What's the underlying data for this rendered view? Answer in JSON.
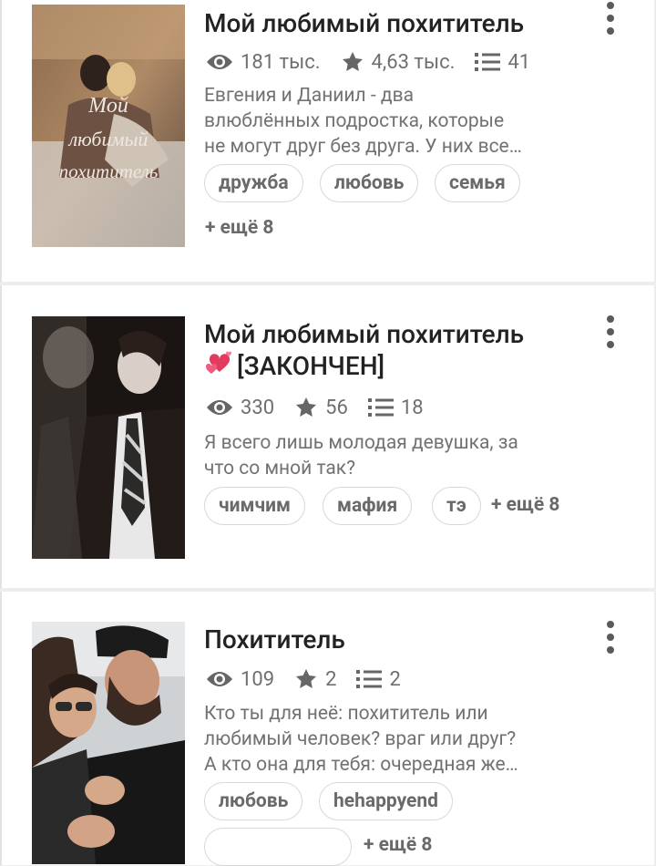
{
  "stories": [
    {
      "title": "Мой любимый похититель",
      "views": "181 тыс.",
      "votes": "4,63 тыс.",
      "parts": "41",
      "description": [
        "Евгения и Даниил - два",
        "влюблённых подростка, которые",
        "не могут друг без друга. У них все…"
      ],
      "tags": [
        "дружба",
        "любовь",
        "семья"
      ],
      "more_tags": "+ ещё 8",
      "cover_text": [
        "Мой",
        "любимый",
        "похититель"
      ]
    },
    {
      "title_line1": "Мой любимый похититель",
      "title_line2": "[ЗАКОНЧЕН]",
      "views": "330",
      "votes": "56",
      "parts": "18",
      "description": [
        "Я всего лишь молодая девушка, за",
        "что со мной так?"
      ],
      "tags": [
        "чимчим",
        "мафия",
        "тэ"
      ],
      "more_tags": "+ ещё 8"
    },
    {
      "title": "Похититель",
      "views": "109",
      "votes": "2",
      "parts": "2",
      "description": [
        "Кто ты для неё: похититель или",
        "любимый человек? враг или друг?",
        "А кто она для тебя: очередная же…"
      ],
      "tags": [
        "любовь",
        "hehappyend"
      ],
      "more_tags": "+ ещё 8"
    }
  ],
  "icons": {
    "views": "eye-icon",
    "votes": "star-icon",
    "parts": "list-icon",
    "menu": "more-vert-icon"
  },
  "colors": {
    "meta": "#6f6f6f",
    "title": "#222222",
    "tag_border": "#d8d8d8"
  }
}
